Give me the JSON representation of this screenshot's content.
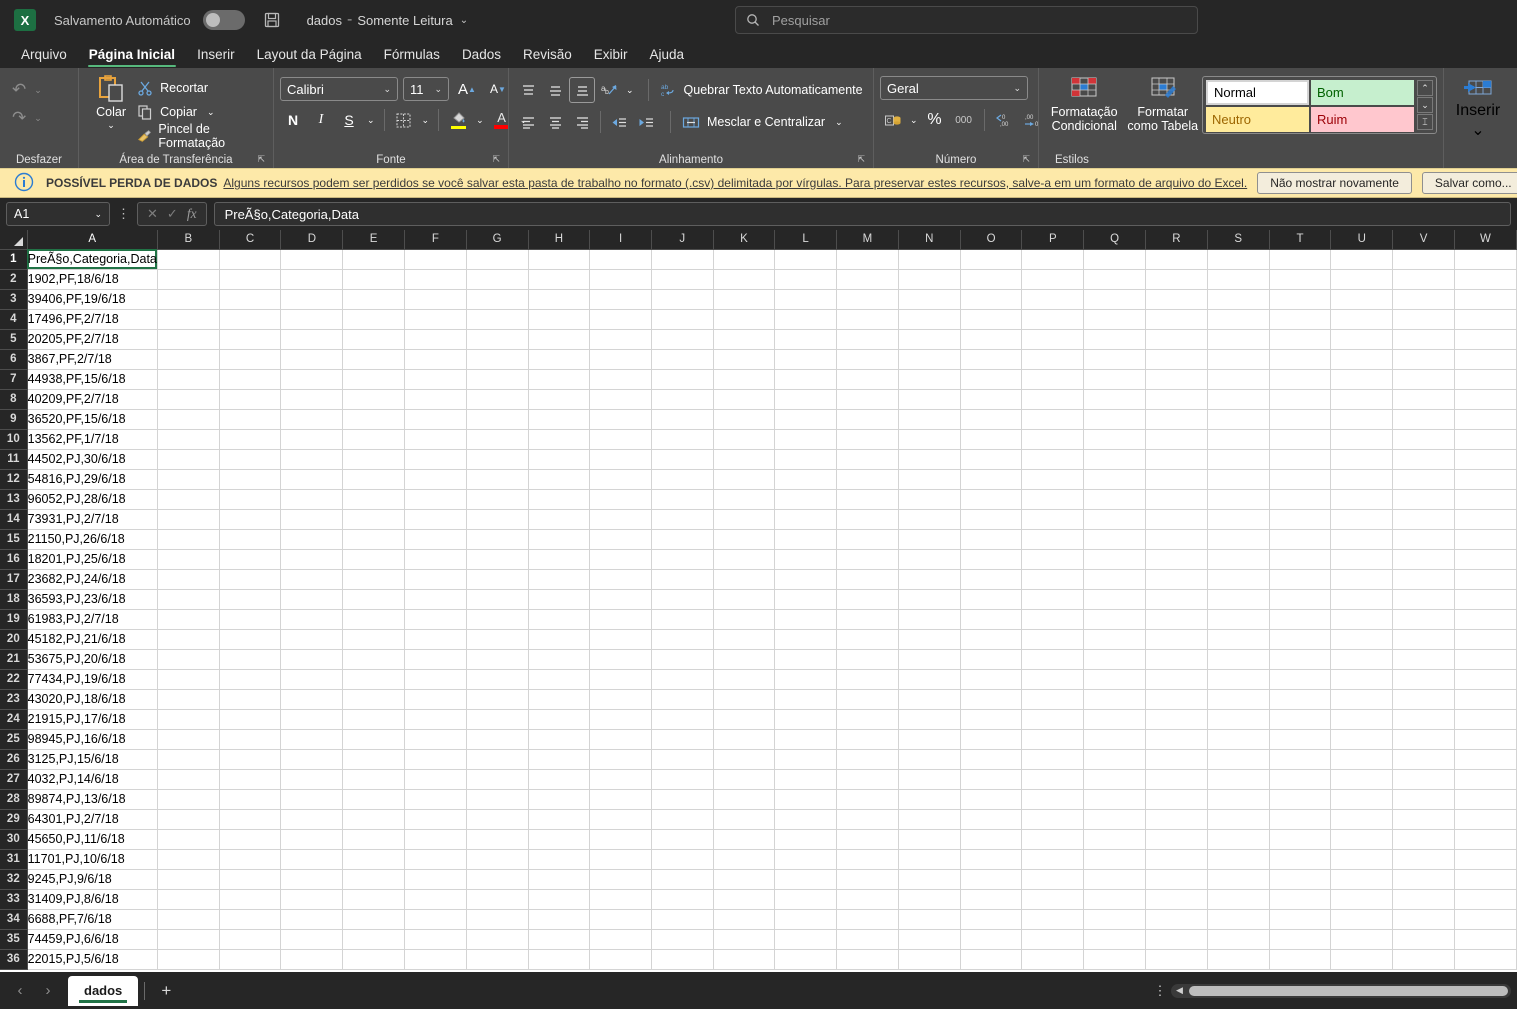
{
  "titlebar": {
    "logo_text": "X",
    "autosave_label": "Salvamento Automático",
    "autosave_state": "off",
    "save_icon": "save-icon",
    "doc_name": "dados",
    "separator": "-",
    "doc_status": "Somente Leitura",
    "dropdown_caret": "⌄"
  },
  "search": {
    "placeholder": "Pesquisar",
    "icon": "search-icon"
  },
  "ribbon_tabs": [
    {
      "label": "Arquivo",
      "active": false
    },
    {
      "label": "Página Inicial",
      "active": true
    },
    {
      "label": "Inserir",
      "active": false
    },
    {
      "label": "Layout da Página",
      "active": false
    },
    {
      "label": "Fórmulas",
      "active": false
    },
    {
      "label": "Dados",
      "active": false
    },
    {
      "label": "Revisão",
      "active": false
    },
    {
      "label": "Exibir",
      "active": false
    },
    {
      "label": "Ajuda",
      "active": false
    }
  ],
  "ribbon": {
    "undo": {
      "group_label": "Desfazer",
      "undo_icon": "undo-icon",
      "redo_icon": "redo-icon",
      "caret": "⌄"
    },
    "clipboard": {
      "group_label": "Área de Transferência",
      "paste_label": "Colar",
      "paste_caret": "⌄",
      "cut_label": "Recortar",
      "copy_label": "Copiar",
      "copy_caret": "⌄",
      "format_painter_label": "Pincel de Formatação",
      "dialog_launcher": "⇱"
    },
    "font": {
      "group_label": "Fonte",
      "font_family": "Calibri",
      "font_size": "11",
      "grow_font": "A",
      "shrink_font": "A",
      "bold": "N",
      "italic": "I",
      "underline": "S",
      "underline_caret": "⌄",
      "borders_caret": "⌄",
      "fill_caret": "⌄",
      "fontcolor_letter": "A",
      "fontcolor_caret": "⌄",
      "dialog_launcher": "⇱"
    },
    "alignment": {
      "group_label": "Alinhamento",
      "wrap_text_label": "Quebrar Texto Automaticamente",
      "merge_label": "Mesclar e Centralizar",
      "merge_caret": "⌄",
      "orientation_caret": "⌄",
      "dialog_launcher": "⇱"
    },
    "number": {
      "group_label": "Número",
      "format": "Geral",
      "format_caret": "⌄",
      "accounting_caret": "⌄",
      "percent": "%",
      "comma": "000",
      "increase_decimal": ".00",
      "decrease_decimal": ".00",
      "dialog_launcher": "⇱"
    },
    "styles": {
      "group_label": "Estilos",
      "conditional_formatting": "Formatação Condicional",
      "conditional_caret": "⌄",
      "format_as_table": "Formatar como Tabela",
      "table_caret": "⌄",
      "gallery": [
        {
          "name": "Normal",
          "class": "s-normal"
        },
        {
          "name": "Bom",
          "class": "s-bom"
        },
        {
          "name": "Neutro",
          "class": "s-neutro"
        },
        {
          "name": "Ruim",
          "class": "s-ruim"
        }
      ],
      "scroll_up": "⌃",
      "scroll_down": "⌄",
      "scroll_more": "⌶"
    },
    "cells": {
      "insert_label": "Inserir",
      "insert_caret": "⌄"
    }
  },
  "banner": {
    "icon": "info-icon",
    "title": "POSSÍVEL PERDA DE DADOS",
    "message": "Alguns recursos podem ser perdidos se você salvar esta pasta de trabalho no formato (.csv) delimitada por vírgulas. Para preservar estes recursos, salve-a em um formato de arquivo do Excel.",
    "dismiss_button": "Não mostrar novamente",
    "saveas_button": "Salvar como..."
  },
  "formulabar": {
    "name_box": "A1",
    "name_caret": "⌄",
    "more_dots": "⋮",
    "cancel_icon": "✕",
    "confirm_icon": "✓",
    "fx_icon": "fx",
    "content": "PreÃ§o,Categoria,Data"
  },
  "grid": {
    "columns": [
      "A",
      "B",
      "C",
      "D",
      "E",
      "F",
      "G",
      "H",
      "I",
      "J",
      "K",
      "L",
      "M",
      "N",
      "O",
      "P",
      "Q",
      "R",
      "S",
      "T",
      "U",
      "V",
      "W"
    ],
    "active_cell": "A1",
    "rows": [
      {
        "n": "1",
        "a": "PreÃ§o,Categoria,Data"
      },
      {
        "n": "2",
        "a": "1902,PF,18/6/18"
      },
      {
        "n": "3",
        "a": "39406,PF,19/6/18"
      },
      {
        "n": "4",
        "a": "17496,PF,2/7/18"
      },
      {
        "n": "5",
        "a": "20205,PF,2/7/18"
      },
      {
        "n": "6",
        "a": "3867,PF,2/7/18"
      },
      {
        "n": "7",
        "a": "44938,PF,15/6/18"
      },
      {
        "n": "8",
        "a": "40209,PF,2/7/18"
      },
      {
        "n": "9",
        "a": "36520,PF,15/6/18"
      },
      {
        "n": "10",
        "a": "13562,PF,1/7/18"
      },
      {
        "n": "11",
        "a": "44502,PJ,30/6/18"
      },
      {
        "n": "12",
        "a": "54816,PJ,29/6/18"
      },
      {
        "n": "13",
        "a": "96052,PJ,28/6/18"
      },
      {
        "n": "14",
        "a": "73931,PJ,2/7/18"
      },
      {
        "n": "15",
        "a": "21150,PJ,26/6/18"
      },
      {
        "n": "16",
        "a": "18201,PJ,25/6/18"
      },
      {
        "n": "17",
        "a": "23682,PJ,24/6/18"
      },
      {
        "n": "18",
        "a": "36593,PJ,23/6/18"
      },
      {
        "n": "19",
        "a": "61983,PJ,2/7/18"
      },
      {
        "n": "20",
        "a": "45182,PJ,21/6/18"
      },
      {
        "n": "21",
        "a": "53675,PJ,20/6/18"
      },
      {
        "n": "22",
        "a": "77434,PJ,19/6/18"
      },
      {
        "n": "23",
        "a": "43020,PJ,18/6/18"
      },
      {
        "n": "24",
        "a": "21915,PJ,17/6/18"
      },
      {
        "n": "25",
        "a": "98945,PJ,16/6/18"
      },
      {
        "n": "26",
        "a": "3125,PJ,15/6/18"
      },
      {
        "n": "27",
        "a": "4032,PJ,14/6/18"
      },
      {
        "n": "28",
        "a": "89874,PJ,13/6/18"
      },
      {
        "n": "29",
        "a": "64301,PJ,2/7/18"
      },
      {
        "n": "30",
        "a": "45650,PJ,11/6/18"
      },
      {
        "n": "31",
        "a": "11701,PJ,10/6/18"
      },
      {
        "n": "32",
        "a": "9245,PJ,9/6/18"
      },
      {
        "n": "33",
        "a": "31409,PJ,8/6/18"
      },
      {
        "n": "34",
        "a": "6688,PF,7/6/18"
      },
      {
        "n": "35",
        "a": "74459,PJ,6/6/18"
      },
      {
        "n": "36",
        "a": "22015,PJ,5/6/18"
      }
    ]
  },
  "sheetbar": {
    "prev_arrow": "‹",
    "next_arrow": "›",
    "tabs": [
      {
        "name": "dados",
        "active": true
      }
    ],
    "add_sheet": "+",
    "more_dots": "⋮",
    "scroll_left_arrow": "◀"
  }
}
